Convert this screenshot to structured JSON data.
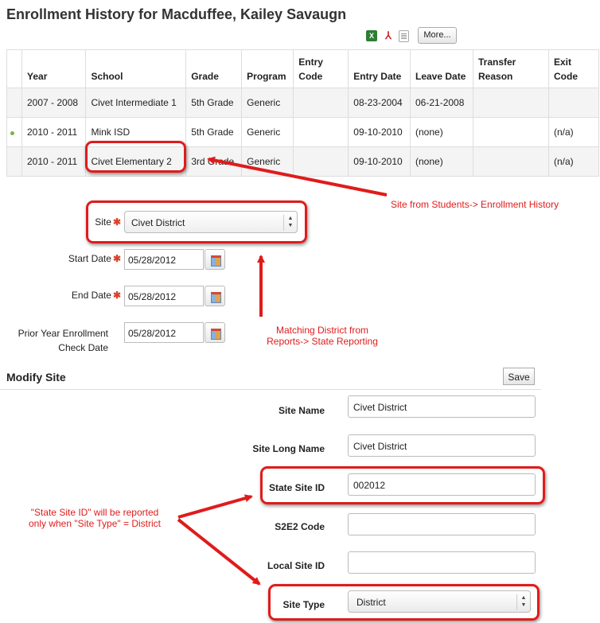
{
  "page_title": "Enrollment History for Macduffee, Kailey Savaugn",
  "toolbar": {
    "icons": [
      "excel-icon",
      "pdf-icon",
      "document-icon"
    ],
    "more_label": "More..."
  },
  "table": {
    "headers": [
      "Year",
      "School",
      "Grade",
      "Program",
      "Entry Code",
      "Entry Date",
      "Leave Date",
      "Transfer Reason",
      "Exit Code"
    ],
    "rows": [
      {
        "active": false,
        "cells": [
          "2007 - 2008",
          "Civet Intermediate 1",
          "5th Grade",
          "Generic",
          "",
          "08-23-2004",
          "06-21-2008",
          "",
          ""
        ]
      },
      {
        "active": true,
        "cells": [
          "2010 - 2011",
          "Mink ISD",
          "5th Grade",
          "Generic",
          "",
          "09-10-2010",
          "(none)",
          "",
          "(n/a)"
        ]
      },
      {
        "active": false,
        "cells": [
          "2010 - 2011",
          "Civet Elementary 2",
          "3rd Grade",
          "Generic",
          "",
          "09-10-2010",
          "(none)",
          "",
          "(n/a)"
        ]
      }
    ]
  },
  "report_form": {
    "site_label": "Site",
    "site_value": "Civet District",
    "start_label": "Start Date",
    "start_value": "05/28/2012",
    "end_label": "End Date",
    "end_value": "05/28/2012",
    "prior_label_1": "Prior Year Enrollment",
    "prior_label_2": "Check Date",
    "prior_value": "05/28/2012",
    "required_mark": "✱"
  },
  "modify_site": {
    "title": "Modify Site",
    "save_label": "Save",
    "fields": {
      "site_name": {
        "label": "Site Name",
        "value": "Civet District"
      },
      "site_long_name": {
        "label": "Site Long Name",
        "value": "Civet District"
      },
      "state_site_id": {
        "label": "State Site ID",
        "value": "002012"
      },
      "s2e2_code": {
        "label": "S2E2 Code",
        "value": ""
      },
      "local_site_id": {
        "label": "Local Site ID",
        "value": ""
      },
      "site_type": {
        "label": "Site Type",
        "value": "District"
      }
    }
  },
  "annotations": {
    "note_site_1": "Site from Students-> Enrollment History",
    "note_district_1": "Matching District from",
    "note_district_2": "Reports-> State Reporting",
    "note_state_1": "\"State Site ID\" will be reported",
    "note_state_2": "only when \"Site Type\" = District"
  },
  "colors": {
    "annotation_red": "#e01b1b",
    "active_dot": "#7cb342",
    "required_star": "#d9432b"
  }
}
